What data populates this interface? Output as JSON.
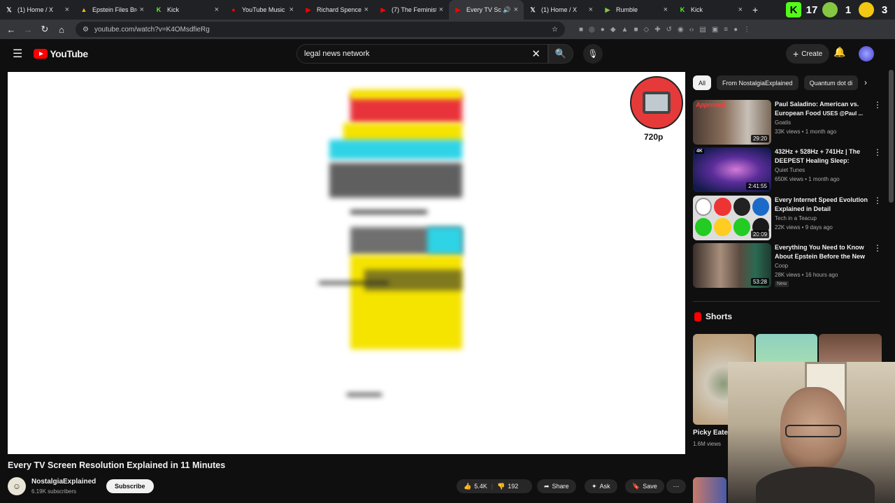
{
  "browser": {
    "tabs": [
      {
        "label": "(1) Home / X",
        "icon": "x-icon"
      },
      {
        "label": "Epstein Files Bro",
        "icon": "drive-icon"
      },
      {
        "label": "Kick",
        "icon": "kick-icon"
      },
      {
        "label": "YouTube Music",
        "icon": "youtube-music-icon"
      },
      {
        "label": "Richard Spencer",
        "icon": "youtube-icon"
      },
      {
        "label": "(7) The Feminist",
        "icon": "youtube-icon"
      },
      {
        "label": "Every TV Sc",
        "icon": "youtube-icon",
        "active": true
      },
      {
        "label": "(1) Home / X",
        "icon": "x-icon"
      },
      {
        "label": "Rumble",
        "icon": "rumble-icon"
      },
      {
        "label": "Kick",
        "icon": "kick-icon"
      }
    ],
    "ext_badges": [
      "K",
      "17",
      "1",
      "3"
    ],
    "url": "youtube.com/watch?v=K4OMsdfieRg"
  },
  "youtube": {
    "logo": "YouTube",
    "search_query": "legal news network",
    "create_label": "Create"
  },
  "player": {
    "quality_label": "720p"
  },
  "video": {
    "title": "Every TV Screen Resolution Explained in 11 Minutes",
    "channel": "NostalgiaExplained",
    "subscribers": "6.19K subscribers",
    "subscribe_label": "Subscribe",
    "likes": "5.4K",
    "dislikes": "192",
    "share_label": "Share",
    "ask_label": "Ask",
    "save_label": "Save"
  },
  "sidebar": {
    "chips": [
      "All",
      "From NostalgiaExplained",
      "Quantum dot di"
    ],
    "recommendations": [
      {
        "title": "Paul Saladino: American vs. European Food",
        "title_tail": "USES @Paul ...",
        "channel": "Goatis",
        "meta": "33K views • 1 month ago",
        "duration": "29:20",
        "thumb_label": "Approved"
      },
      {
        "title": "432Hz + 528Hz + 741Hz | The DEEPEST Healing Sleep: Whol...",
        "channel": "Quiet Tunes",
        "meta": "650K views • 1 month ago",
        "duration": "2:41:55",
        "thumb_label": "4K"
      },
      {
        "title": "Every Internet Speed Evolution Explained in Detail",
        "channel": "Tech in a Teacup",
        "meta": "22K views • 9 days ago",
        "duration": "20:09"
      },
      {
        "title": "Everything You Need to Know About Epstein Before the New ...",
        "channel": "Coop",
        "meta": "28K views • 16 hours ago",
        "duration": "53:28",
        "badge": "New"
      }
    ],
    "shorts_heading": "Shorts",
    "short_title": "Picky Eate",
    "short_views": "1.6M views"
  },
  "colors": {
    "background": "#0f0f0f",
    "accent": "#ff0000",
    "text": "#f1f1f1",
    "secondary_text": "#aaaaaa"
  }
}
